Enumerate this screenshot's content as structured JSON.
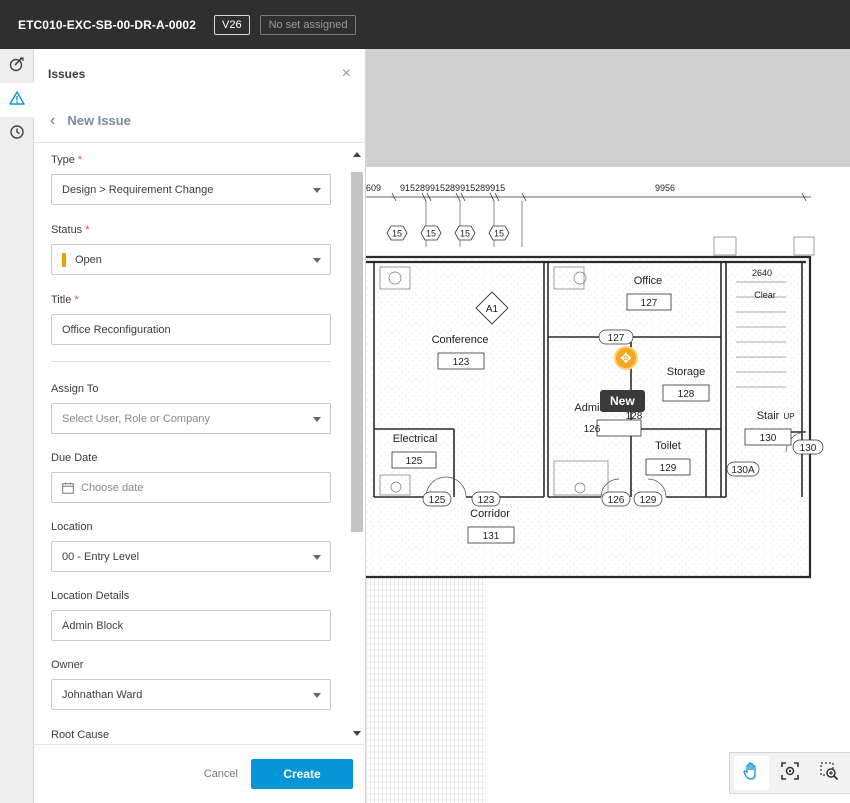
{
  "header": {
    "document_title": "ETC010-EXC-SB-00-DR-A-0002",
    "version": "V26",
    "set_badge": "No set assigned"
  },
  "rail": {
    "icons": [
      "markup-icon",
      "issues-icon",
      "history-icon"
    ]
  },
  "panel": {
    "title": "Issues",
    "close_glyph": "×",
    "subtitle": "New Issue",
    "back_glyph": "‹"
  },
  "form": {
    "type": {
      "label": "Type",
      "required": "*",
      "value": "Design > Requirement Change"
    },
    "status": {
      "label": "Status",
      "required": "*",
      "value": "Open",
      "color": "#f0a000"
    },
    "title": {
      "label": "Title",
      "required": "*",
      "value": "Office Reconfiguration"
    },
    "assign_to": {
      "label": "Assign To",
      "placeholder": "Select User, Role or Company"
    },
    "due_date": {
      "label": "Due Date",
      "placeholder": "Choose date"
    },
    "location": {
      "label": "Location",
      "value": "00 - Entry Level"
    },
    "location_details": {
      "label": "Location Details",
      "value": "Admin Block"
    },
    "owner": {
      "label": "Owner",
      "value": "Johnathan Ward"
    },
    "root_cause": {
      "label": "Root Cause"
    }
  },
  "footer": {
    "cancel_label": "Cancel",
    "create_label": "Create",
    "accent": "#0696d7"
  },
  "drawing": {
    "dimensions": [
      "609",
      "915289915289915289915",
      "9956",
      "2640"
    ],
    "grid_tags": [
      "15",
      "15",
      "15",
      "15"
    ],
    "tag_a1": "A1",
    "rooms": [
      {
        "name": "Office",
        "number": "127"
      },
      {
        "name": "Conference",
        "number": "123"
      },
      {
        "name": "Storage",
        "number": "128"
      },
      {
        "name": "Admin",
        "number": "126"
      },
      {
        "name": "Electrical",
        "number": "125"
      },
      {
        "name": "Toilet",
        "number": "129"
      },
      {
        "name": "Stair",
        "number": "130"
      },
      {
        "name": "Corridor",
        "number": "131"
      }
    ],
    "door_tags": [
      "127",
      "125",
      "123",
      "126",
      "129",
      "130A",
      "130",
      "128"
    ],
    "clear_label": "Clear",
    "up_label": "UP",
    "new_tooltip": "New"
  },
  "viewer_tools": [
    "pan-icon",
    "fit-to-view-icon",
    "zoom-window-icon"
  ]
}
